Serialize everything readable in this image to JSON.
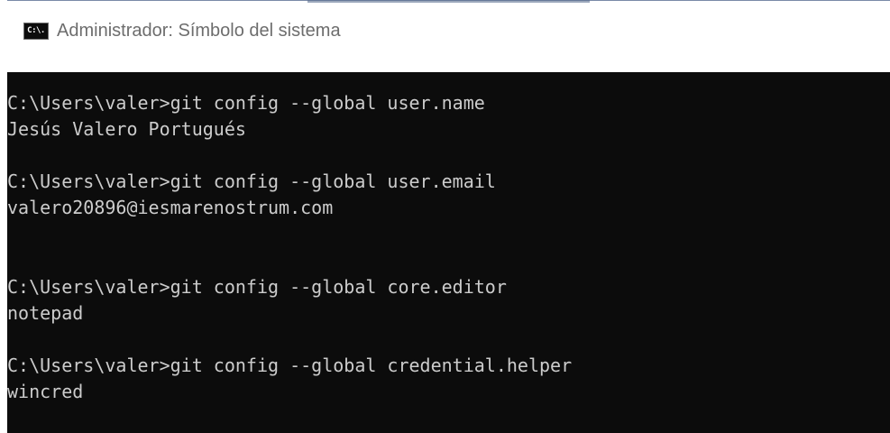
{
  "window": {
    "title": "Administrador: Símbolo del sistema",
    "icon_label": "C:\\.",
    "icon": "cmd-icon"
  },
  "console": {
    "lines": [
      "C:\\Users\\valer>git config --global user.name",
      "Jesús Valero Portugués",
      "",
      "C:\\Users\\valer>git config --global user.email",
      "valero20896@iesmarenostrum.com",
      "",
      "C:\\Users\\valer>git config --global core.editor",
      "notepad",
      "",
      "C:\\Users\\valer>git config --global credential.helper",
      "wincred"
    ]
  },
  "colors": {
    "console_bg": "#0c0c0c",
    "console_text": "#cccccc",
    "title_text": "#6d6d6d"
  }
}
